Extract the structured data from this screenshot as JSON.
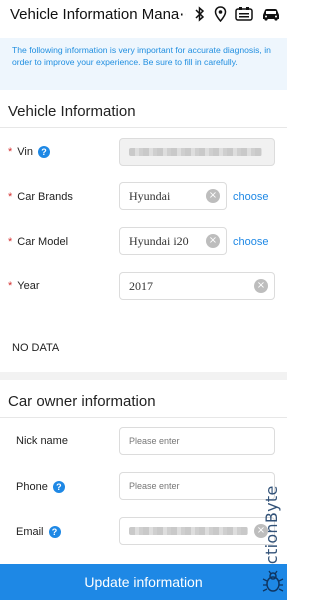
{
  "header": {
    "title": "Vehicle Information Mana⋯",
    "icons": [
      "bluetooth-icon",
      "location-pin-icon",
      "obd-connector-icon",
      "car-icon"
    ]
  },
  "notice": {
    "text": "The following information is very important for accurate diagnosis, in order to improve your experience. Be sure to fill in carefully."
  },
  "vehicle_info": {
    "section_title": "Vehicle Information",
    "vin_label": "Vin",
    "car_brands_label": "Car Brands",
    "car_brands_value": "Hyundai",
    "car_model_label": "Car Model",
    "car_model_value": "Hyundai i20",
    "year_label": "Year",
    "year_value": "2017",
    "choose_label": "choose",
    "required_mark": "*"
  },
  "no_data": "NO DATA",
  "owner_info": {
    "section_title": "Car owner information",
    "nickname_label": "Nick name",
    "nickname_placeholder": "Please enter",
    "phone_label": "Phone",
    "phone_placeholder": "Please enter",
    "email_label": "Email"
  },
  "watermark": "JunctionByte",
  "update_button": "Update information",
  "colors": {
    "accent": "#1e88e5",
    "required": "#d32f2f",
    "notice_bg": "#eef6fd"
  }
}
